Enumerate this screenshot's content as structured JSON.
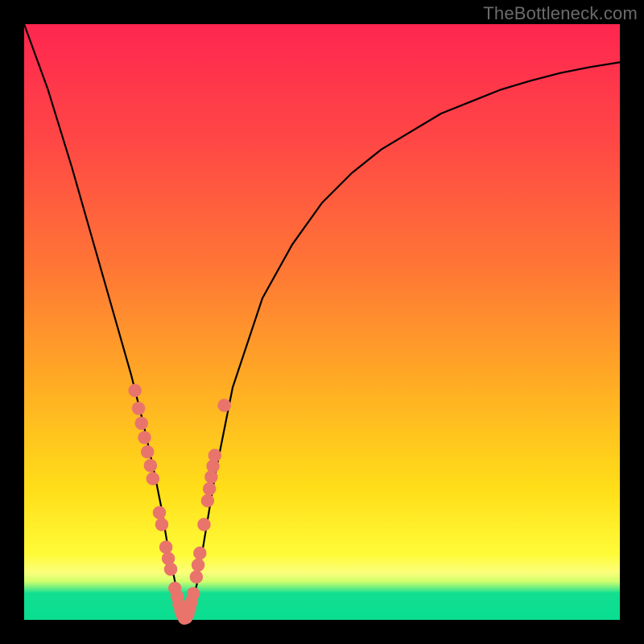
{
  "watermark": "TheBottleneck.com",
  "colors": {
    "page_bg": "#000000",
    "curve": "#000000",
    "marker": "#e9746c",
    "gradient_stops": [
      "#ff2650",
      "#ff4845",
      "#ff7436",
      "#ffa825",
      "#ffde18",
      "#fffb38",
      "#fbff7a",
      "#d3ff6e",
      "#96f57a",
      "#46e98a",
      "#12de90",
      "#0ade91"
    ]
  },
  "chart_data": {
    "type": "line",
    "title": "",
    "xlabel": "",
    "ylabel": "",
    "xlim": [
      0,
      100
    ],
    "ylim": [
      0,
      100
    ],
    "grid": false,
    "legend": false,
    "series": [
      {
        "name": "bottleneck-curve",
        "x": [
          0,
          4,
          8,
          12,
          16,
          18,
          20,
          22,
          23,
          24,
          25,
          26,
          27,
          28,
          29,
          30,
          32,
          35,
          40,
          45,
          50,
          55,
          60,
          65,
          70,
          75,
          80,
          85,
          90,
          95,
          100
        ],
        "values": [
          100,
          89,
          76,
          62,
          48,
          41,
          33,
          24,
          19,
          13,
          8,
          3,
          0,
          2,
          6,
          12,
          24,
          39,
          54,
          63,
          70,
          75,
          79,
          82,
          85,
          87,
          89,
          90.5,
          91.8,
          92.8,
          93.6
        ]
      }
    ],
    "markers": {
      "name": "highlight-points",
      "points": [
        {
          "x": 18.6,
          "y": 38.5
        },
        {
          "x": 19.2,
          "y": 35.5
        },
        {
          "x": 19.7,
          "y": 33.0
        },
        {
          "x": 20.2,
          "y": 30.6
        },
        {
          "x": 20.7,
          "y": 28.2
        },
        {
          "x": 21.2,
          "y": 25.9
        },
        {
          "x": 21.6,
          "y": 23.7
        },
        {
          "x": 22.7,
          "y": 18.0
        },
        {
          "x": 23.1,
          "y": 16.0
        },
        {
          "x": 23.8,
          "y": 12.2
        },
        {
          "x": 24.2,
          "y": 10.3
        },
        {
          "x": 24.6,
          "y": 8.5
        },
        {
          "x": 25.3,
          "y": 5.3
        },
        {
          "x": 25.7,
          "y": 3.9
        },
        {
          "x": 26.0,
          "y": 2.6
        },
        {
          "x": 26.3,
          "y": 1.5
        },
        {
          "x": 26.6,
          "y": 0.8
        },
        {
          "x": 26.9,
          "y": 0.3
        },
        {
          "x": 27.2,
          "y": 0.4
        },
        {
          "x": 27.5,
          "y": 1.0
        },
        {
          "x": 27.8,
          "y": 2.0
        },
        {
          "x": 28.1,
          "y": 3.1
        },
        {
          "x": 28.4,
          "y": 4.4
        },
        {
          "x": 28.9,
          "y": 7.2
        },
        {
          "x": 29.2,
          "y": 9.2
        },
        {
          "x": 29.5,
          "y": 11.2
        },
        {
          "x": 30.2,
          "y": 16.0
        },
        {
          "x": 30.8,
          "y": 20.0
        },
        {
          "x": 31.1,
          "y": 22.0
        },
        {
          "x": 31.4,
          "y": 24.0
        },
        {
          "x": 31.7,
          "y": 25.8
        },
        {
          "x": 32.0,
          "y": 27.6
        },
        {
          "x": 33.6,
          "y": 36.0
        }
      ]
    }
  }
}
